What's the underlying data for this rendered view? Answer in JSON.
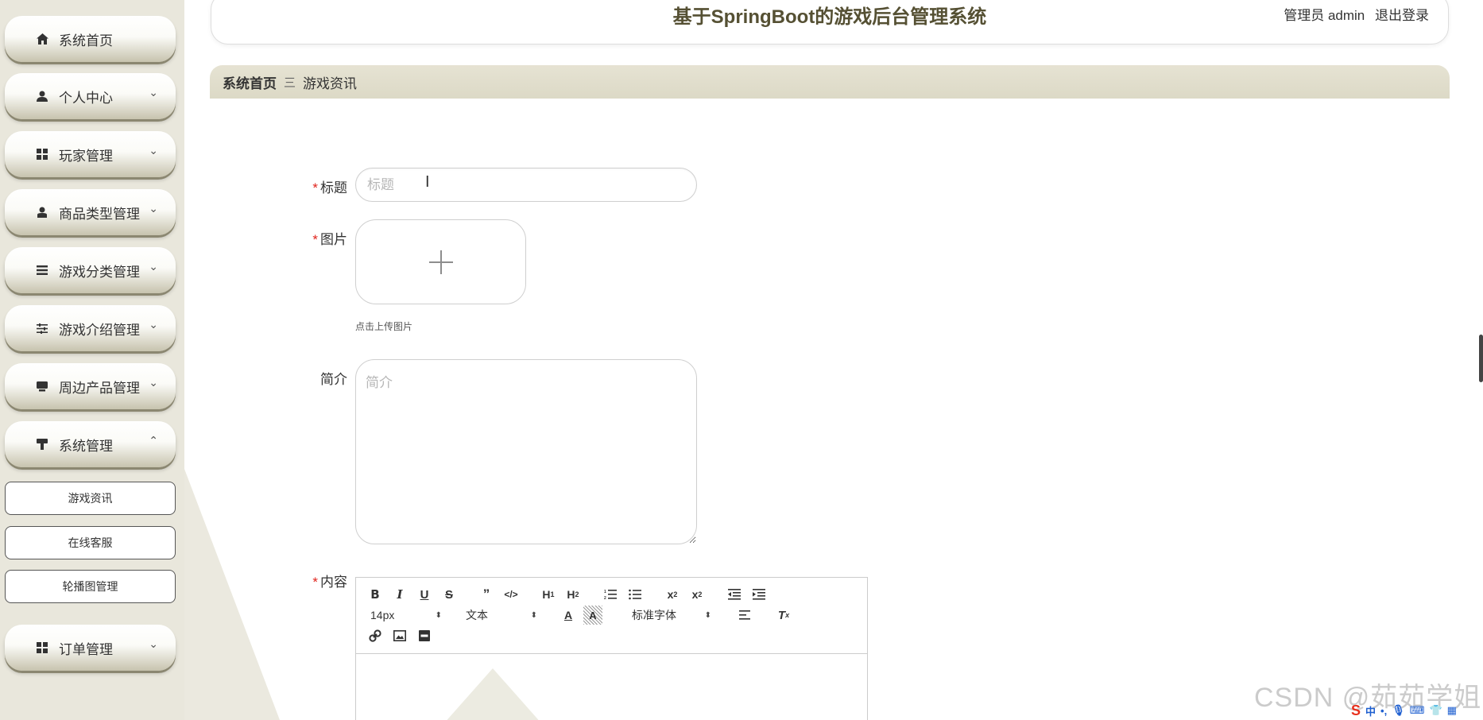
{
  "header": {
    "app_title": "基于SpringBoot的游戏后台管理系统",
    "user_label": "管理员 admin",
    "logout_label": "退出登录"
  },
  "sidebar": {
    "items": [
      {
        "label": "系统首页",
        "icon": "home-icon",
        "expandable": false
      },
      {
        "label": "个人中心",
        "icon": "user-icon",
        "expandable": true
      },
      {
        "label": "玩家管理",
        "icon": "grid-icon",
        "expandable": true
      },
      {
        "label": "商品类型管理",
        "icon": "user-tie-icon",
        "expandable": true
      },
      {
        "label": "游戏分类管理",
        "icon": "list-icon",
        "expandable": true
      },
      {
        "label": "游戏介绍管理",
        "icon": "sliders-icon",
        "expandable": true
      },
      {
        "label": "周边产品管理",
        "icon": "display-icon",
        "expandable": true
      },
      {
        "label": "系统管理",
        "icon": "brush-icon",
        "expandable": true,
        "expanded": true
      },
      {
        "label": "订单管理",
        "icon": "grid-icon",
        "expandable": true
      }
    ],
    "sub_items": [
      "游戏资讯",
      "在线客服",
      "轮播图管理"
    ]
  },
  "breadcrumb": {
    "home": "系统首页",
    "separator": "三",
    "current": "游戏资讯"
  },
  "form": {
    "title_label": "标题",
    "title_placeholder": "标题",
    "title_value": "",
    "image_label": "图片",
    "upload_hint": "点击上传图片",
    "intro_label": "简介",
    "intro_placeholder": "简介",
    "content_label": "内容"
  },
  "editor": {
    "row1_buttons": [
      "B",
      "I",
      "U",
      "S",
      "99",
      "</>",
      "H1",
      "H2",
      "ordered-list-icon",
      "bullet-list-icon",
      "X2",
      "X²",
      "indent-decrease-icon",
      "indent-increase-icon"
    ],
    "font_size": "14px",
    "text_style": "文本",
    "font_family": "标准字体",
    "row3_buttons": [
      "link-icon",
      "image-icon",
      "video-icon"
    ]
  },
  "watermark": "CSDN @茹茹学姐",
  "ime": {
    "mode": "中"
  },
  "colors": {
    "sidebar_bg": "#e9e7dc",
    "title_color": "#555033",
    "required_star": "#e0231c",
    "breadcrumb_bg": "#dcd9c6"
  }
}
